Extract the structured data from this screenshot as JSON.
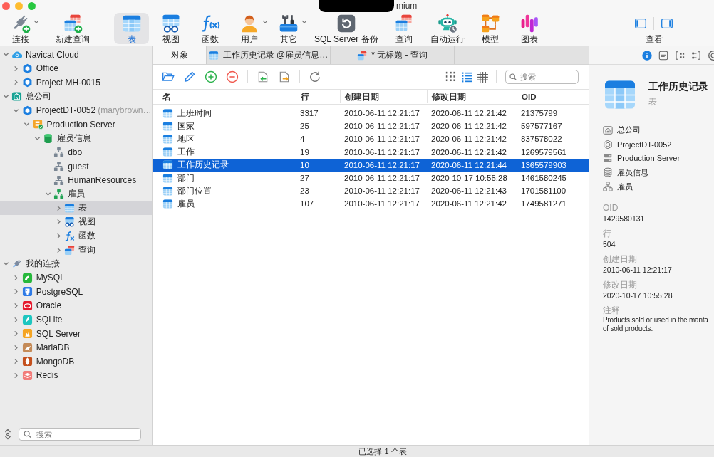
{
  "window": {
    "title": "mium"
  },
  "toolbar": {
    "groups": [
      {
        "items": [
          {
            "kind": "connect",
            "label": "连接",
            "dropdown": true,
            "selected": false
          },
          {
            "kind": "new_query",
            "label": "新建查询",
            "dropdown": false,
            "selected": false
          }
        ]
      },
      {
        "items": [
          {
            "kind": "table",
            "label": "表",
            "dropdown": false,
            "selected": true
          },
          {
            "kind": "view",
            "label": "视图",
            "dropdown": false,
            "selected": false
          },
          {
            "kind": "function",
            "label": "函数",
            "dropdown": false,
            "selected": false
          },
          {
            "kind": "user",
            "label": "用户",
            "dropdown": true,
            "selected": false
          },
          {
            "kind": "other",
            "label": "其它",
            "dropdown": true,
            "selected": false
          },
          {
            "kind": "backup",
            "label": "SQL Server 备份",
            "dropdown": false,
            "selected": false
          },
          {
            "kind": "query",
            "label": "查询",
            "dropdown": false,
            "selected": false
          },
          {
            "kind": "automation",
            "label": "自动运行",
            "dropdown": false,
            "selected": false
          },
          {
            "kind": "model",
            "label": "模型",
            "dropdown": false,
            "selected": false
          },
          {
            "kind": "chart",
            "label": "图表",
            "dropdown": false,
            "selected": false
          }
        ]
      }
    ],
    "view": {
      "label": "查看",
      "panels": [
        {
          "kind": "left",
          "on": true
        },
        {
          "kind": "right",
          "on": true
        }
      ]
    }
  },
  "sidebar": {
    "tree": [
      {
        "label": "Navicat Cloud",
        "kind": "cloud",
        "expanded": true,
        "selected": false,
        "children": [
          {
            "label": "Office",
            "kind": "project",
            "expanded": false,
            "selected": false
          },
          {
            "label": "Project MH-0015",
            "kind": "project",
            "expanded": false,
            "selected": false
          }
        ]
      },
      {
        "label": "总公司",
        "kind": "company",
        "expanded": true,
        "selected": false,
        "children": [
          {
            "label": "ProjectDT-0052",
            "note": "(marybrown…",
            "kind": "project",
            "expanded": true,
            "selected": false,
            "children": [
              {
                "label": "Production Server",
                "kind": "server",
                "expanded": true,
                "selected": false,
                "children": [
                  {
                    "label": "雇员信息",
                    "kind": "database",
                    "expanded": true,
                    "selected": false,
                    "children": [
                      {
                        "label": "dbo",
                        "kind": "schema",
                        "selected": false
                      },
                      {
                        "label": "guest",
                        "kind": "schema",
                        "selected": false
                      },
                      {
                        "label": "HumanResources",
                        "kind": "schema",
                        "selected": false
                      },
                      {
                        "label": "雇员",
                        "kind": "schema_active",
                        "expanded": true,
                        "selected": false,
                        "children": [
                          {
                            "label": "表",
                            "kind": "table",
                            "expanded": false,
                            "selected": true
                          },
                          {
                            "label": "视图",
                            "kind": "view",
                            "expanded": false,
                            "selected": false
                          },
                          {
                            "label": "函数",
                            "kind": "function",
                            "expanded": false,
                            "selected": false
                          },
                          {
                            "label": "查询",
                            "kind": "query",
                            "expanded": false,
                            "selected": false
                          }
                        ]
                      }
                    ]
                  }
                ]
              }
            ]
          }
        ]
      },
      {
        "label": "我的连接",
        "kind": "connections",
        "expanded": true,
        "selected": false,
        "children": [
          {
            "label": "MySQL",
            "kind": "mysql",
            "expanded": false,
            "selected": false
          },
          {
            "label": "PostgreSQL",
            "kind": "postgresql",
            "expanded": false,
            "selected": false
          },
          {
            "label": "Oracle",
            "kind": "oracle",
            "expanded": false,
            "selected": false
          },
          {
            "label": "SQLite",
            "kind": "sqlite",
            "expanded": false,
            "selected": false
          },
          {
            "label": "SQL Server",
            "kind": "sqlserver",
            "expanded": false,
            "selected": false
          },
          {
            "label": "MariaDB",
            "kind": "mariadb",
            "expanded": false,
            "selected": false
          },
          {
            "label": "MongoDB",
            "kind": "mongodb",
            "expanded": false,
            "selected": false
          },
          {
            "label": "Redis",
            "kind": "redis",
            "expanded": false,
            "selected": false
          }
        ]
      }
    ],
    "search": {
      "placeholder": "搜索"
    }
  },
  "main": {
    "tabs": [
      {
        "label": "对象",
        "kind": "objects",
        "selected": true
      },
      {
        "label": "工作历史记录 @雇员信息…",
        "kind": "table",
        "selected": false
      },
      {
        "label": "* 无标题 - 查询",
        "kind": "query",
        "selected": false
      }
    ],
    "toolbar": {
      "views": [
        {
          "kind": "grid",
          "selected": false
        },
        {
          "kind": "list",
          "selected": true
        },
        {
          "kind": "detail",
          "selected": false
        }
      ],
      "search": {
        "placeholder": "搜索"
      }
    },
    "table": {
      "columns": [
        "名",
        "行",
        "创建日期",
        "修改日期",
        "OID"
      ],
      "rows": [
        {
          "cells": [
            "上班时间",
            "3317",
            "2010-06-11 12:21:17",
            "2020-06-11 12:21:42",
            "21375799"
          ],
          "selected": false
        },
        {
          "cells": [
            "国家",
            "25",
            "2010-06-11 12:21:17",
            "2020-06-11 12:21:42",
            "597577167"
          ],
          "selected": false
        },
        {
          "cells": [
            "地区",
            "4",
            "2010-06-11 12:21:17",
            "2020-06-11 12:21:42",
            "837578022"
          ],
          "selected": false
        },
        {
          "cells": [
            "工作",
            "19",
            "2010-06-11 12:21:17",
            "2020-06-11 12:21:42",
            "1269579561"
          ],
          "selected": false
        },
        {
          "cells": [
            "工作历史记录",
            "10",
            "2010-06-11 12:21:17",
            "2020-06-11 12:21:44",
            "1365579903"
          ],
          "selected": true
        },
        {
          "cells": [
            "部门",
            "27",
            "2010-06-11 12:21:17",
            "2020-10-17 10:55:28",
            "1461580245"
          ],
          "selected": false
        },
        {
          "cells": [
            "部门位置",
            "23",
            "2010-06-11 12:21:17",
            "2020-06-11 12:21:43",
            "1701581100"
          ],
          "selected": false
        },
        {
          "cells": [
            "雇员",
            "107",
            "2010-06-11 12:21:17",
            "2020-06-11 12:21:42",
            "1749581271"
          ],
          "selected": false
        }
      ]
    }
  },
  "inspector": {
    "tabs": [
      {
        "kind": "info",
        "selected": true
      },
      {
        "kind": "ddl",
        "selected": false
      },
      {
        "kind": "usage",
        "selected": false
      },
      {
        "kind": "dependency",
        "selected": false
      },
      {
        "kind": "more",
        "selected": false
      }
    ],
    "title": "工作历史记录",
    "type": "表",
    "path": [
      {
        "kind": "company",
        "label": "总公司"
      },
      {
        "kind": "project",
        "label": "ProjectDT-0052"
      },
      {
        "kind": "server",
        "label": "Production Server"
      },
      {
        "kind": "database",
        "label": "雇员信息"
      },
      {
        "kind": "schema",
        "label": "雇员"
      }
    ],
    "fields": [
      {
        "label": "OID",
        "value": "1429580131"
      },
      {
        "label": "行",
        "value": "504"
      },
      {
        "label": "创建日期",
        "value": "2010-06-11 12:21:17"
      },
      {
        "label": "修改日期",
        "value": "2020-10-17 10:55:28"
      }
    ],
    "comment": {
      "label": "注释",
      "lines": [
        "Products sold or used in the manfa",
        "of sold products."
      ]
    }
  },
  "status_bar": {
    "text": "已选择 1 个表"
  }
}
